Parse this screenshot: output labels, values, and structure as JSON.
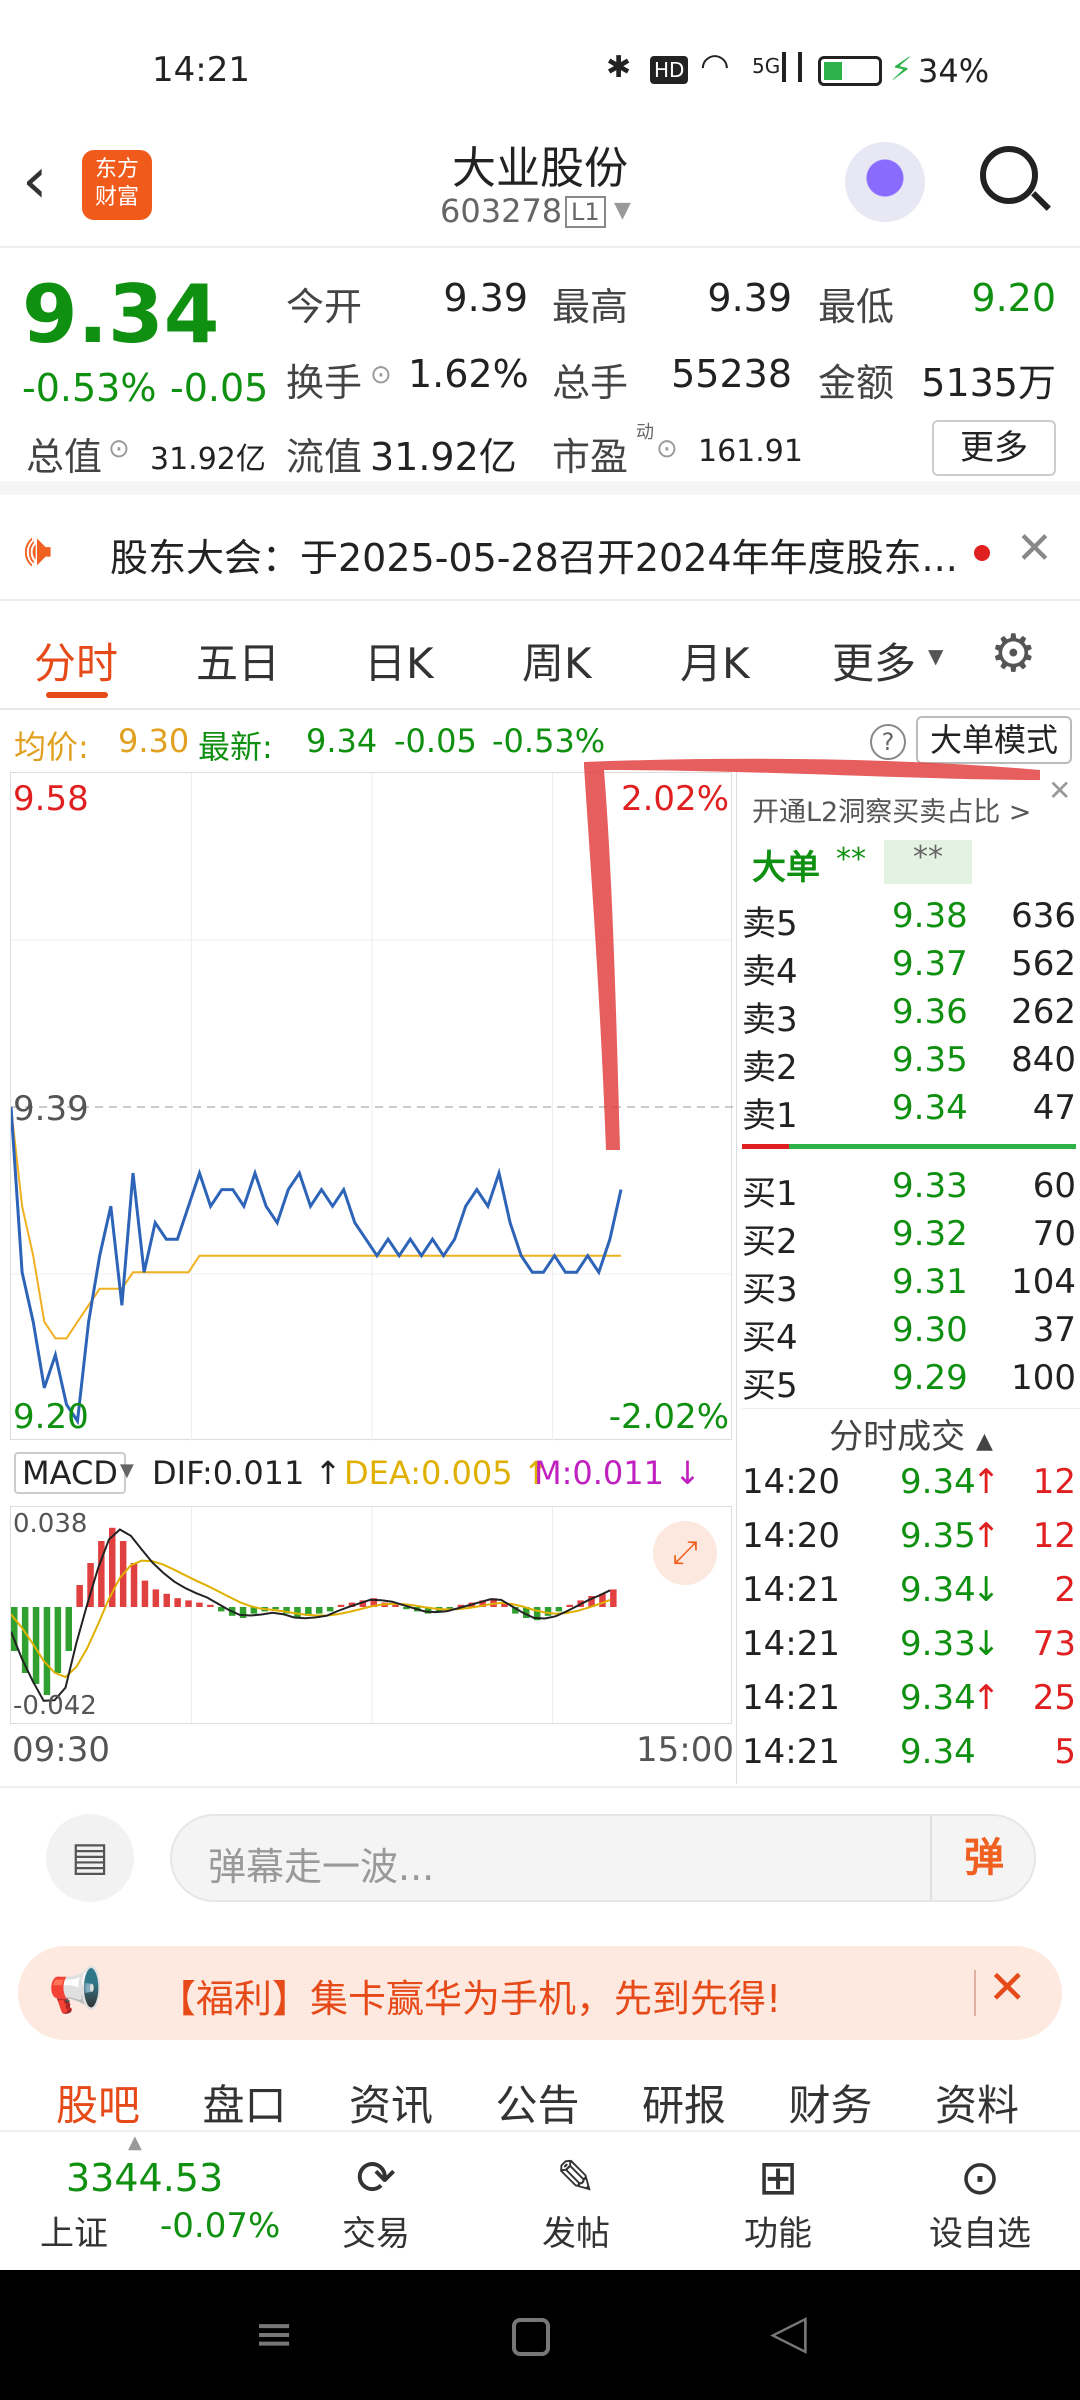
{
  "status_bar": {
    "time": "14:21",
    "battery": "34%",
    "network": "5G"
  },
  "header": {
    "title": "大业股份",
    "code": "603278",
    "level_badge": "L1",
    "logo_text": "东方\n财富"
  },
  "quote": {
    "price": "9.34",
    "change_pct": "-0.53%",
    "change": "-0.05",
    "open_label": "今开",
    "open": "9.39",
    "high_label": "最高",
    "high": "9.39",
    "low_label": "最低",
    "low": "9.20",
    "turnover_label": "换手",
    "turnover": "1.62%",
    "volume_label": "总手",
    "volume": "55238",
    "amount_label": "金额",
    "amount": "5135万",
    "mktcap_label": "总值",
    "mktcap": "31.92亿",
    "float_label": "流值",
    "float": "31.92亿",
    "pe_label": "市盈",
    "pe_sup": "动",
    "pe": "161.91",
    "more_button": "更多"
  },
  "notice": {
    "text": "股东大会：于2025-05-28召开2024年年度股东..."
  },
  "tabs": [
    "分时",
    "五日",
    "日K",
    "周K",
    "月K",
    "更多"
  ],
  "info_line": {
    "avg_label": "均价:",
    "avg": "9.30",
    "latest_label": "最新:",
    "latest": "9.34",
    "chg": "-0.05",
    "pct": "-0.53%",
    "mode_button": "大单模式"
  },
  "chart_data": {
    "type": "line",
    "title": "",
    "x": [
      "09:30",
      "15:00"
    ],
    "ylim": [
      9.2,
      9.58
    ],
    "y_labels": {
      "top": "9.58",
      "mid": "9.39",
      "bottom": "9.20",
      "top_pct": "2.02%",
      "bottom_pct": "-2.02%"
    },
    "series": [
      {
        "name": "",
        "color": "#2e64b8",
        "values": [
          9.39,
          9.29,
          9.26,
          9.22,
          9.24,
          9.21,
          9.2,
          9.26,
          9.3,
          9.33,
          9.27,
          9.35,
          9.29,
          9.32,
          9.31,
          9.31,
          9.33,
          9.35,
          9.33,
          9.34,
          9.34,
          9.33,
          9.35,
          9.33,
          9.32,
          9.34,
          9.35,
          9.33,
          9.34,
          9.33,
          9.34,
          9.32,
          9.31,
          9.3,
          9.31,
          9.3,
          9.31,
          9.3,
          9.31,
          9.3,
          9.31,
          9.33,
          9.34,
          9.33,
          9.35,
          9.32,
          9.3,
          9.29,
          9.29,
          9.3,
          9.29,
          9.29,
          9.3,
          9.29,
          9.31,
          9.34
        ]
      },
      {
        "name": "",
        "color": "#f0b020",
        "values": [
          9.39,
          9.33,
          9.3,
          9.26,
          9.25,
          9.25,
          9.26,
          9.27,
          9.28,
          9.28,
          9.28,
          9.29,
          9.29,
          9.29,
          9.29,
          9.29,
          9.29,
          9.3,
          9.3,
          9.3,
          9.3,
          9.3,
          9.3,
          9.3,
          9.3,
          9.3,
          9.3,
          9.3,
          9.3,
          9.3,
          9.3,
          9.3,
          9.3,
          9.3,
          9.3,
          9.3,
          9.3,
          9.3,
          9.3,
          9.3,
          9.3,
          9.3,
          9.3,
          9.3,
          9.3,
          9.3,
          9.3,
          9.3,
          9.3,
          9.3,
          9.3,
          9.3,
          9.3,
          9.3,
          9.3,
          9.3
        ]
      }
    ]
  },
  "macd": {
    "label": "MACD",
    "dif": "DIF:0.011 ↑",
    "dea": "DEA:0.005 ↑",
    "m": "M:0.011 ↓",
    "top": "0.038",
    "bottom": "-0.042",
    "bars": [
      -0.02,
      -0.03,
      -0.035,
      -0.04,
      -0.03,
      -0.02,
      0.01,
      0.02,
      0.03,
      0.036,
      0.03,
      0.02,
      0.012,
      0.008,
      0.006,
      0.004,
      0.003,
      0.002,
      0.001,
      -0.002,
      -0.004,
      -0.005,
      -0.003,
      -0.002,
      -0.001,
      -0.003,
      -0.005,
      -0.004,
      -0.003,
      -0.002,
      0.001,
      0.002,
      0.003,
      0.004,
      0.002,
      0.001,
      -0.001,
      -0.002,
      -0.003,
      -0.002,
      -0.001,
      0.001,
      0.002,
      0.003,
      0.004,
      0.002,
      -0.003,
      -0.005,
      -0.006,
      -0.004,
      -0.002,
      0.001,
      0.003,
      0.005,
      0.006,
      0.008
    ]
  },
  "orderbook": {
    "promo": "开通L2洞察买卖占比 >",
    "dadan_label": "大单",
    "stars": "**",
    "asks": [
      {
        "label": "卖5",
        "price": "9.38",
        "vol": "636"
      },
      {
        "label": "卖4",
        "price": "9.37",
        "vol": "562"
      },
      {
        "label": "卖3",
        "price": "9.36",
        "vol": "262"
      },
      {
        "label": "卖2",
        "price": "9.35",
        "vol": "840"
      },
      {
        "label": "卖1",
        "price": "9.34",
        "vol": "47"
      }
    ],
    "bids": [
      {
        "label": "买1",
        "price": "9.33",
        "vol": "60"
      },
      {
        "label": "买2",
        "price": "9.32",
        "vol": "70"
      },
      {
        "label": "买3",
        "price": "9.31",
        "vol": "104"
      },
      {
        "label": "买4",
        "price": "9.30",
        "vol": "37"
      },
      {
        "label": "买5",
        "price": "9.29",
        "vol": "100"
      }
    ]
  },
  "trades": {
    "title": "分时成交",
    "rows": [
      {
        "time": "14:20",
        "price": "9.34",
        "arrow": "↑",
        "vol": "12"
      },
      {
        "time": "14:20",
        "price": "9.35",
        "arrow": "↑",
        "vol": "12"
      },
      {
        "time": "14:21",
        "price": "9.34",
        "arrow": "↓",
        "vol": "2"
      },
      {
        "time": "14:21",
        "price": "9.33",
        "arrow": "↓",
        "vol": "73"
      },
      {
        "time": "14:21",
        "price": "9.34",
        "arrow": "↑",
        "vol": "25"
      },
      {
        "time": "14:21",
        "price": "9.34",
        "arrow": "",
        "vol": "5"
      }
    ]
  },
  "danmaku": {
    "placeholder": "弹幕走一波...",
    "send": "弹"
  },
  "promo_banner": {
    "text": "【福利】集卡赢华为手机，先到先得!"
  },
  "bottom_tabs": [
    "股吧",
    "盘口",
    "资讯",
    "公告",
    "研报",
    "财务",
    "资料"
  ],
  "index": {
    "value": "3344.53",
    "name": "上证",
    "pct": "-0.07%"
  },
  "bottom_nav": [
    "交易",
    "发帖",
    "功能",
    "设自选"
  ]
}
